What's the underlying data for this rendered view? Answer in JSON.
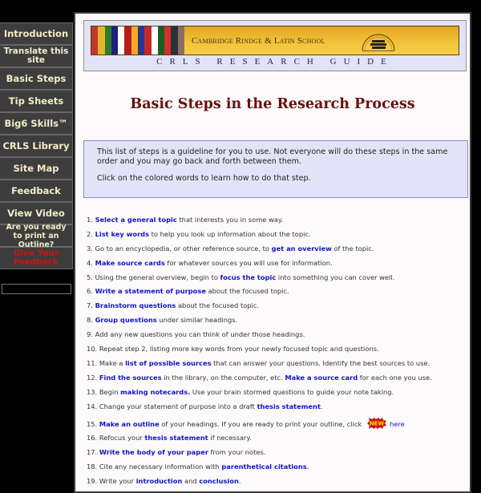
{
  "sidebar": {
    "items": [
      {
        "label": "Introduction"
      },
      {
        "label": "Translate this site"
      },
      {
        "label": "Basic Steps"
      },
      {
        "label": "Tip Sheets"
      },
      {
        "label": "Big6 Skills™"
      },
      {
        "label": "CRLS Library"
      },
      {
        "label": "Site Map"
      },
      {
        "label": "Feedback"
      },
      {
        "label": "View Video"
      },
      {
        "label": "Are you ready to print an Outline?"
      },
      {
        "label": "Give Your Feedback"
      }
    ]
  },
  "header": {
    "school_name": "Cambridge Rindge & Latin School",
    "guide_title": "CRLS RESEARCH GUIDE",
    "seal_icon": "school-seal-books",
    "flag_colors": [
      "#c0392b",
      "#e8b428",
      "#2e7d32",
      "#1a237e",
      "#ffffff",
      "#b71c1c",
      "#f9a825",
      "#283593",
      "#c62828",
      "#ffffff",
      "#1b5e20",
      "#d32f2f",
      "#263238",
      "#8d6e63"
    ]
  },
  "page": {
    "title": "Basic Steps in the Research Process",
    "intro": [
      "This list of steps is a guideline for you to use. Not everyone will do these steps in the same order and you may go back and forth between them.",
      "Click on the colored words to learn how to do that step."
    ]
  },
  "steps": [
    {
      "num": "1.",
      "parts": [
        {
          "link": "Select a general topic"
        },
        {
          "text": " that interests you in some way."
        }
      ]
    },
    {
      "num": "2.",
      "parts": [
        {
          "link": "List key words"
        },
        {
          "text": " to help you look up information about the topic."
        }
      ]
    },
    {
      "num": "3.",
      "parts": [
        {
          "text": "Go to an encyclopedia, or other reference source, to "
        },
        {
          "link": "get an overview"
        },
        {
          "text": " of the topic."
        }
      ]
    },
    {
      "num": "4.",
      "parts": [
        {
          "link": "Make source cards"
        },
        {
          "text": " for whatever sources you will use for information."
        }
      ]
    },
    {
      "num": "5.",
      "parts": [
        {
          "text": "Using the general overview, begin to "
        },
        {
          "link": "focus the topic"
        },
        {
          "text": " into something you can cover well."
        }
      ]
    },
    {
      "num": "6.",
      "parts": [
        {
          "link": "Write a statement of purpose"
        },
        {
          "text": " about the focused topic."
        }
      ]
    },
    {
      "num": "7.",
      "parts": [
        {
          "link": "Brainstorm questions"
        },
        {
          "text": " about the focused topic."
        }
      ]
    },
    {
      "num": "8.",
      "parts": [
        {
          "link": "Group questions"
        },
        {
          "text": " under similar headings."
        }
      ]
    },
    {
      "num": "9.",
      "parts": [
        {
          "text": "Add any new questions you can think of under those headings."
        }
      ]
    },
    {
      "num": "10.",
      "parts": [
        {
          "text": "Repeat step 2, listing more key words from your newly focused topic and questions."
        }
      ]
    },
    {
      "num": "11.",
      "parts": [
        {
          "text": "Make a "
        },
        {
          "link": "list of possible sources"
        },
        {
          "text": " that can answer your questions. Identify the best sources to use."
        }
      ]
    },
    {
      "num": "12.",
      "parts": [
        {
          "link": "Find the sources"
        },
        {
          "text": " in the library, on the computer, etc. "
        },
        {
          "link": "Make a source card"
        },
        {
          "text": " for each one you use."
        }
      ]
    },
    {
      "num": "13.",
      "parts": [
        {
          "text": "Begin "
        },
        {
          "link": "making notecards."
        },
        {
          "text": " Use your brain stormed questions to guide your note taking."
        }
      ]
    },
    {
      "num": "14.",
      "parts": [
        {
          "text": "Change your statement of purpose into a draft "
        },
        {
          "link": "thesis statement"
        },
        {
          "text": "."
        }
      ]
    },
    {
      "num": "15.",
      "parts": [
        {
          "link": "Make an outline"
        },
        {
          "text": " of your headings. If you are ready to print your outline, click "
        },
        {
          "badge": "NEW"
        },
        {
          "plainlink": "here"
        }
      ]
    },
    {
      "num": "16.",
      "parts": [
        {
          "text": "Refocus your "
        },
        {
          "link": "thesis statement"
        },
        {
          "text": " if necessary."
        }
      ]
    },
    {
      "num": "17.",
      "parts": [
        {
          "link": "Write the body of your paper"
        },
        {
          "text": " from your notes."
        }
      ]
    },
    {
      "num": "18.",
      "parts": [
        {
          "text": "Cite any necessary information with "
        },
        {
          "link": "parenthetical citations"
        },
        {
          "text": "."
        }
      ]
    },
    {
      "num": "19.",
      "parts": [
        {
          "text": "Write your "
        },
        {
          "link": "introduction"
        },
        {
          "text": " and "
        },
        {
          "link": "conclusion"
        },
        {
          "text": "."
        }
      ]
    }
  ]
}
